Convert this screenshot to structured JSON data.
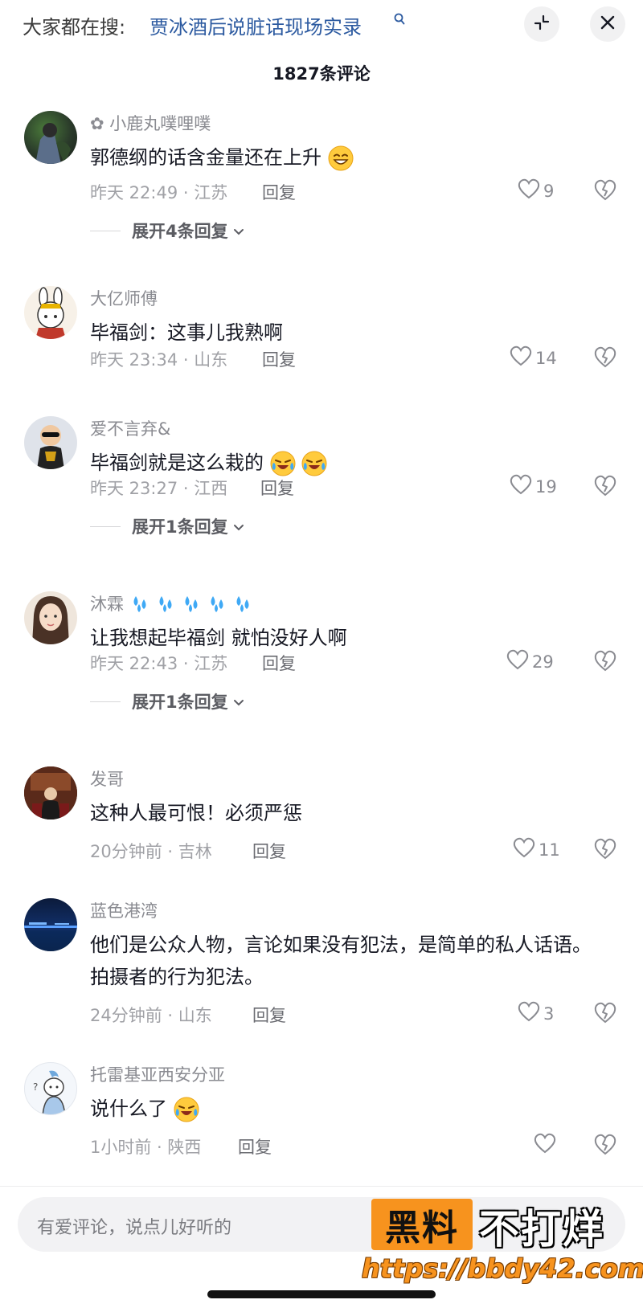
{
  "topbar": {
    "search_prefix": "大家都在搜:",
    "search_query": "贾冰酒后说脏话现场实录",
    "collapse_icon": "collapse-icon",
    "close_icon": "close-icon"
  },
  "comment_count": "1827条评论",
  "reply_label": "回复",
  "comments": [
    {
      "username": "✿ 小鹿丸噗哩噗",
      "text": "郭德纲的话含金量还在上升",
      "emoji": "grin-emoji",
      "meta": "昨天 22:49 · 江苏",
      "likes": "9",
      "expand": "展开4条回复"
    },
    {
      "username": "大亿师傅",
      "text": "毕福剑：这事儿我熟啊",
      "meta": "昨天 23:34 · 山东",
      "likes": "14"
    },
    {
      "username": "爱不言弃&",
      "text": "毕福剑就是这么栽的",
      "emoji": "crying-laughing-emoji",
      "meta": "昨天 23:27 · 江西",
      "likes": "19",
      "expand": "展开1条回复"
    },
    {
      "username": "沐霖",
      "username_emoji": "sweat-droplets-emoji",
      "text": "让我想起毕福剑 就怕没好人啊",
      "meta": "昨天 22:43 · 江苏",
      "likes": "29",
      "expand": "展开1条回复"
    },
    {
      "username": "发哥",
      "text": "这种人最可恨！必须严惩",
      "meta": "20分钟前 · 吉林",
      "likes": "11"
    },
    {
      "username": "蓝色港湾",
      "text": "他们是公众人物，言论如果没有犯法，是简单的私人话语。拍摄者的行为犯法。",
      "meta": "24分钟前 · 山东",
      "likes": "3"
    },
    {
      "username": "托雷基亚西安分亚",
      "text": "说什么了",
      "emoji": "crying-laughing-emoji",
      "meta": "1小时前 · 陕西",
      "likes": ""
    }
  ],
  "input": {
    "placeholder": "有爱评论，说点儿好听的"
  },
  "watermark": {
    "box_text": "黑料",
    "word": "不打烊",
    "url": "https://bbdy42.com",
    "accent": "#f7931e"
  }
}
